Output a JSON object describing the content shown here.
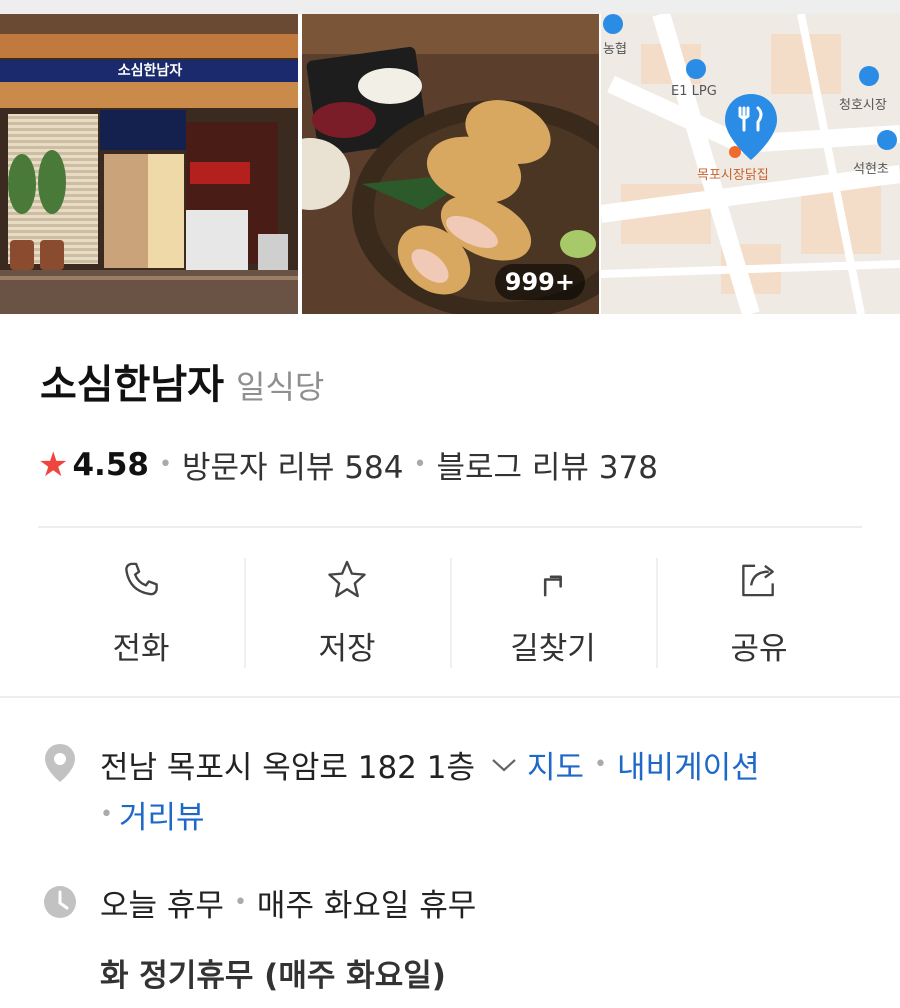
{
  "place": {
    "name": "소심한남자",
    "category": "일식당",
    "rating": "4.58",
    "visitor_reviews": "방문자 리뷰 584",
    "blog_reviews": "블로그 리뷰 378",
    "rating_icon": "star-icon"
  },
  "photos": {
    "storefront_sign": "소심한남자",
    "count_badge": "999+"
  },
  "map_preview": {
    "labels": {
      "lpg": "E1 LPG",
      "market": "청호시장",
      "restaurant": "목포시장닭집",
      "school": "석현초",
      "partial": "농협"
    },
    "pin_color": "#2b8ce6"
  },
  "actions": [
    {
      "label": "전화",
      "icon": "phone-icon"
    },
    {
      "label": "저장",
      "icon": "star-outline-icon"
    },
    {
      "label": "길찾기",
      "icon": "directions-icon"
    },
    {
      "label": "공유",
      "icon": "share-icon"
    }
  ],
  "address": {
    "text": "전남 목포시 옥암로 182 1층",
    "map_link": "지도",
    "nav_link": "내비게이션",
    "street_view_link": "거리뷰",
    "icon": "location-pin-icon"
  },
  "hours": {
    "status": "오늘 휴무",
    "note": "매주 화요일 휴무",
    "detail": "화  정기휴무 (매주 화요일)",
    "icon": "clock-icon"
  },
  "colors": {
    "link": "#1e68c8",
    "star": "#f0443e"
  }
}
